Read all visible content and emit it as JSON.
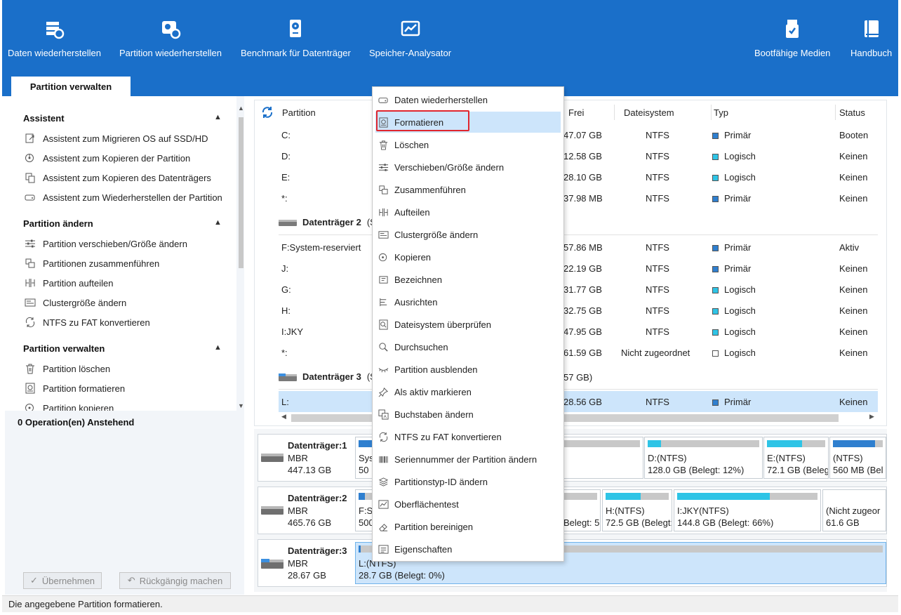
{
  "toolbar": {
    "items": [
      {
        "label": "Daten wiederherstellen",
        "icon": "data-recovery-icon"
      },
      {
        "label": "Partition wiederherstellen",
        "icon": "partition-recovery-icon"
      },
      {
        "label": "Benchmark für Datenträger",
        "icon": "disk-benchmark-icon"
      },
      {
        "label": "Speicher-Analysator",
        "icon": "space-analyzer-icon"
      },
      {
        "label": "Bootfähige Medien",
        "icon": "bootable-media-icon"
      },
      {
        "label": "Handbuch",
        "icon": "manual-book-icon"
      }
    ],
    "active_tab": "Partition verwalten"
  },
  "sidebar": {
    "sections": [
      {
        "title": "Assistent",
        "items": [
          "Assistent zum Migrieren OS auf SSD/HD",
          "Assistent zum Kopieren der Partition",
          "Assistent zum Kopieren des Datenträgers",
          "Assistent zum Wiederherstellen der Partition"
        ]
      },
      {
        "title": "Partition ändern",
        "items": [
          "Partition verschieben/Größe ändern",
          "Partitionen zusammenführen",
          "Partition aufteilen",
          "Clustergröße ändern",
          "NTFS zu FAT konvertieren"
        ]
      },
      {
        "title": "Partition verwalten",
        "items": [
          "Partition löschen",
          "Partition formatieren",
          "Partition kopieren"
        ]
      }
    ],
    "pending": "0 Operation(en) Anstehend",
    "apply_label": "Übernehmen",
    "undo_label": "Rückgängig machen"
  },
  "table": {
    "columns": [
      "Partition",
      "Frei",
      "Dateisystem",
      "Typ",
      "Status"
    ],
    "colors": {
      "primary": "#2f7fcf",
      "logical": "#2ec4e6",
      "unallocated": "#ffffff"
    },
    "rows": [
      {
        "partition": "C:",
        "free": "47.07 GB",
        "fs": "NTFS",
        "type": "Primär",
        "status": "Booten"
      },
      {
        "partition": "D:",
        "free": "12.58 GB",
        "fs": "NTFS",
        "type": "Logisch",
        "status": "Keinen"
      },
      {
        "partition": "E:",
        "free": "28.10 GB",
        "fs": "NTFS",
        "type": "Logisch",
        "status": "Keinen"
      },
      {
        "partition": "*:",
        "free": "37.98 MB",
        "fs": "NTFS",
        "type": "Primär",
        "status": "Keinen"
      },
      {
        "disk": "Datenträger 2",
        "suffix": "(S"
      },
      {
        "partition": "F:System-reserviert",
        "free": "57.86 MB",
        "fs": "NTFS",
        "type": "Primär",
        "status": "Aktiv"
      },
      {
        "partition": "J:",
        "free": "22.19 GB",
        "fs": "NTFS",
        "type": "Primär",
        "status": "Keinen"
      },
      {
        "partition": "G:",
        "free": "31.77 GB",
        "fs": "NTFS",
        "type": "Logisch",
        "status": "Keinen"
      },
      {
        "partition": "H:",
        "free": "32.75 GB",
        "fs": "NTFS",
        "type": "Logisch",
        "status": "Keinen"
      },
      {
        "partition": "I:JKY",
        "free": "47.95 GB",
        "fs": "NTFS",
        "type": "Logisch",
        "status": "Keinen"
      },
      {
        "partition": "*:",
        "free": "61.59 GB",
        "fs": "Nicht zugeordnet",
        "type": "Logisch",
        "status": "Keinen"
      },
      {
        "disk": "Datenträger 3",
        "suffix": "(S",
        "extra": "57 GB)"
      },
      {
        "partition": "L:",
        "free": "28.56 GB",
        "fs": "NTFS",
        "type": "Primär",
        "status": "Keinen",
        "selected": true
      }
    ]
  },
  "diskmap": [
    {
      "name": "Datenträger:1",
      "scheme": "MBR",
      "size": "447.13 GB",
      "partitions": [
        {
          "t1": "Syst",
          "t2": "50 M",
          "used": 0.6,
          "color": "#2f7fcf"
        },
        {
          "t1": "",
          "t2": "",
          "used": 0,
          "color": "#2f7fcf"
        },
        {
          "t1": "D:(NTFS)",
          "t2": "128.0 GB (Belegt: 12%)",
          "used": 0.12,
          "color": "#2ec4e6"
        },
        {
          "t1": "E:(NTFS)",
          "t2": "72.1 GB (Beleg",
          "used": 0.6,
          "color": "#2ec4e6"
        },
        {
          "t1": "(NTFS)",
          "t2": "560 MB (Bel",
          "used": 0.85,
          "color": "#2f7fcf"
        }
      ]
    },
    {
      "name": "Datenträger:2",
      "scheme": "MBR",
      "size": "465.76 GB",
      "partitions": [
        {
          "t1": "F:Sy",
          "t2": "500",
          "used": 0.3,
          "color": "#2f7fcf"
        },
        {
          "t1": "",
          "t2": "Belegt: 5",
          "used": 0.1,
          "color": "#2ec4e6"
        },
        {
          "t1": "H:(NTFS)",
          "t2": "72.5 GB (Belegt:",
          "used": 0.55,
          "color": "#2ec4e6"
        },
        {
          "t1": "I:JKY(NTFS)",
          "t2": "144.8 GB (Belegt: 66%)",
          "used": 0.66,
          "color": "#2ec4e6"
        },
        {
          "t1": "(Nicht zugeor",
          "t2": "61.6 GB",
          "used": 0,
          "color": "#c8c8c8"
        }
      ]
    },
    {
      "name": "Datenträger:3",
      "scheme": "MBR",
      "size": "28.67 GB",
      "partitions": [
        {
          "t1": "L:(NTFS)",
          "t2": "28.7 GB (Belegt: 0%)",
          "used": 0.005,
          "color": "#2f7fcf",
          "selected": true
        }
      ]
    }
  ],
  "context_menu": {
    "items": [
      {
        "label": "Daten wiederherstellen",
        "icon": "drive-recover-icon"
      },
      {
        "label": "Formatieren",
        "icon": "format-icon",
        "highlighted": true
      },
      {
        "label": "Löschen",
        "icon": "trash-icon"
      },
      {
        "label": "Verschieben/Größe ändern",
        "icon": "sliders-icon"
      },
      {
        "label": "Zusammenführen",
        "icon": "merge-icon"
      },
      {
        "label": "Aufteilen",
        "icon": "split-icon"
      },
      {
        "label": "Clustergröße ändern",
        "icon": "cluster-icon"
      },
      {
        "label": "Kopieren",
        "icon": "copy-disc-icon"
      },
      {
        "label": "Bezeichnen",
        "icon": "label-icon"
      },
      {
        "label": "Ausrichten",
        "icon": "align-icon"
      },
      {
        "label": "Dateisystem überprüfen",
        "icon": "check-fs-icon"
      },
      {
        "label": "Durchsuchen",
        "icon": "search-icon"
      },
      {
        "label": "Partition ausblenden",
        "icon": "hide-eye-icon"
      },
      {
        "label": "Als aktiv markieren",
        "icon": "pin-icon"
      },
      {
        "label": "Buchstaben ändern",
        "icon": "letter-icon"
      },
      {
        "label": "NTFS zu FAT konvertieren",
        "icon": "convert-icon"
      },
      {
        "label": "Seriennummer der Partition ändern",
        "icon": "barcode-icon"
      },
      {
        "label": "Partitionstyp-ID ändern",
        "icon": "layers-icon"
      },
      {
        "label": "Oberflächentest",
        "icon": "surface-test-icon"
      },
      {
        "label": "Partition bereinigen",
        "icon": "eraser-icon"
      },
      {
        "label": "Eigenschaften",
        "icon": "properties-icon"
      }
    ]
  },
  "status_bar": "Die angegebene Partition formatieren."
}
